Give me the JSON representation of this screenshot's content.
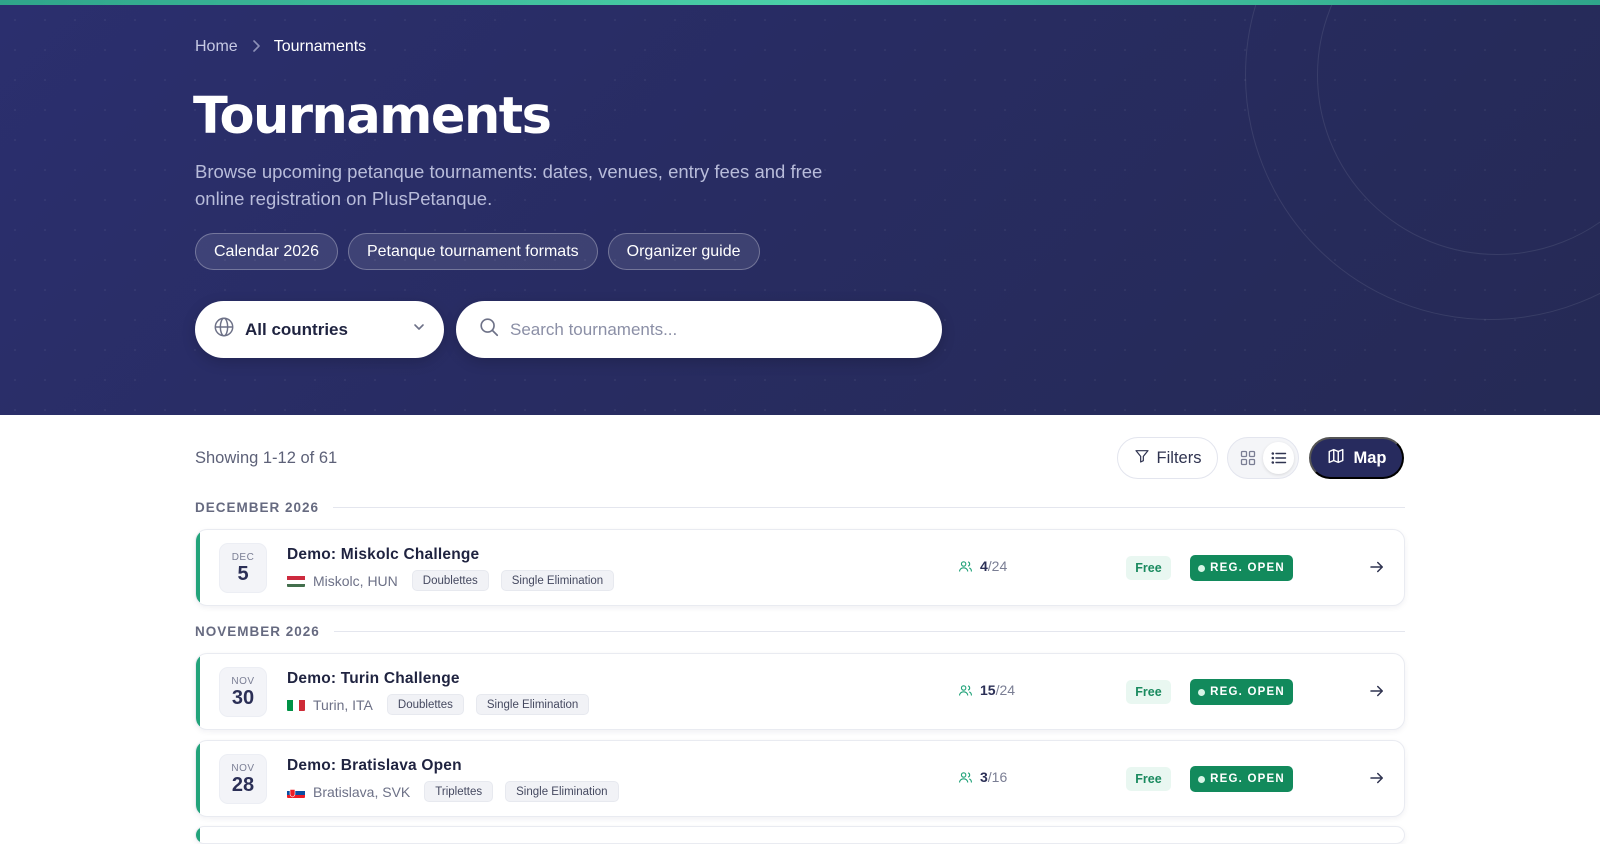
{
  "breadcrumb": {
    "home": "Home",
    "current": "Tournaments"
  },
  "hero": {
    "title": "Tournaments",
    "subtitle": "Browse upcoming petanque tournaments: dates, venues, entry fees and free online registration on PlusPetanque.",
    "chips": [
      "Calendar 2026",
      "Petanque tournament formats",
      "Organizer guide"
    ]
  },
  "search": {
    "country_selected": "All countries",
    "placeholder": "Search tournaments..."
  },
  "toolbar": {
    "showing": "Showing 1-12 of 61",
    "filters_label": "Filters",
    "map_label": "Map",
    "active_view": "list"
  },
  "months": [
    "DECEMBER 2026",
    "NOVEMBER 2026"
  ],
  "tournaments": [
    {
      "month": "DEC",
      "day": "5",
      "name": "Demo: Miskolc Challenge",
      "location": "Miskolc, HUN",
      "flag": "hungary-flag",
      "format": "Doublettes",
      "bracket": "Single Elimination",
      "registered": "4",
      "capacity": "/24",
      "fee": "Free",
      "status": "REG. OPEN"
    },
    {
      "month": "NOV",
      "day": "30",
      "name": "Demo: Turin Challenge",
      "location": "Turin, ITA",
      "flag": "italy-flag",
      "format": "Doublettes",
      "bracket": "Single Elimination",
      "registered": "15",
      "capacity": "/24",
      "fee": "Free",
      "status": "REG. OPEN"
    },
    {
      "month": "NOV",
      "day": "28",
      "name": "Demo: Bratislava Open",
      "location": "Bratislava, SVK",
      "flag": "slovakia-flag",
      "format": "Triplettes",
      "bracket": "Single Elimination",
      "registered": "3",
      "capacity": "/16",
      "fee": "Free",
      "status": "REG. OPEN"
    }
  ],
  "colors": {
    "hero_bg": "#2b2f6e",
    "accent_green": "#22a37a",
    "status_green": "#128a5c",
    "map_button": "#272b5e"
  }
}
